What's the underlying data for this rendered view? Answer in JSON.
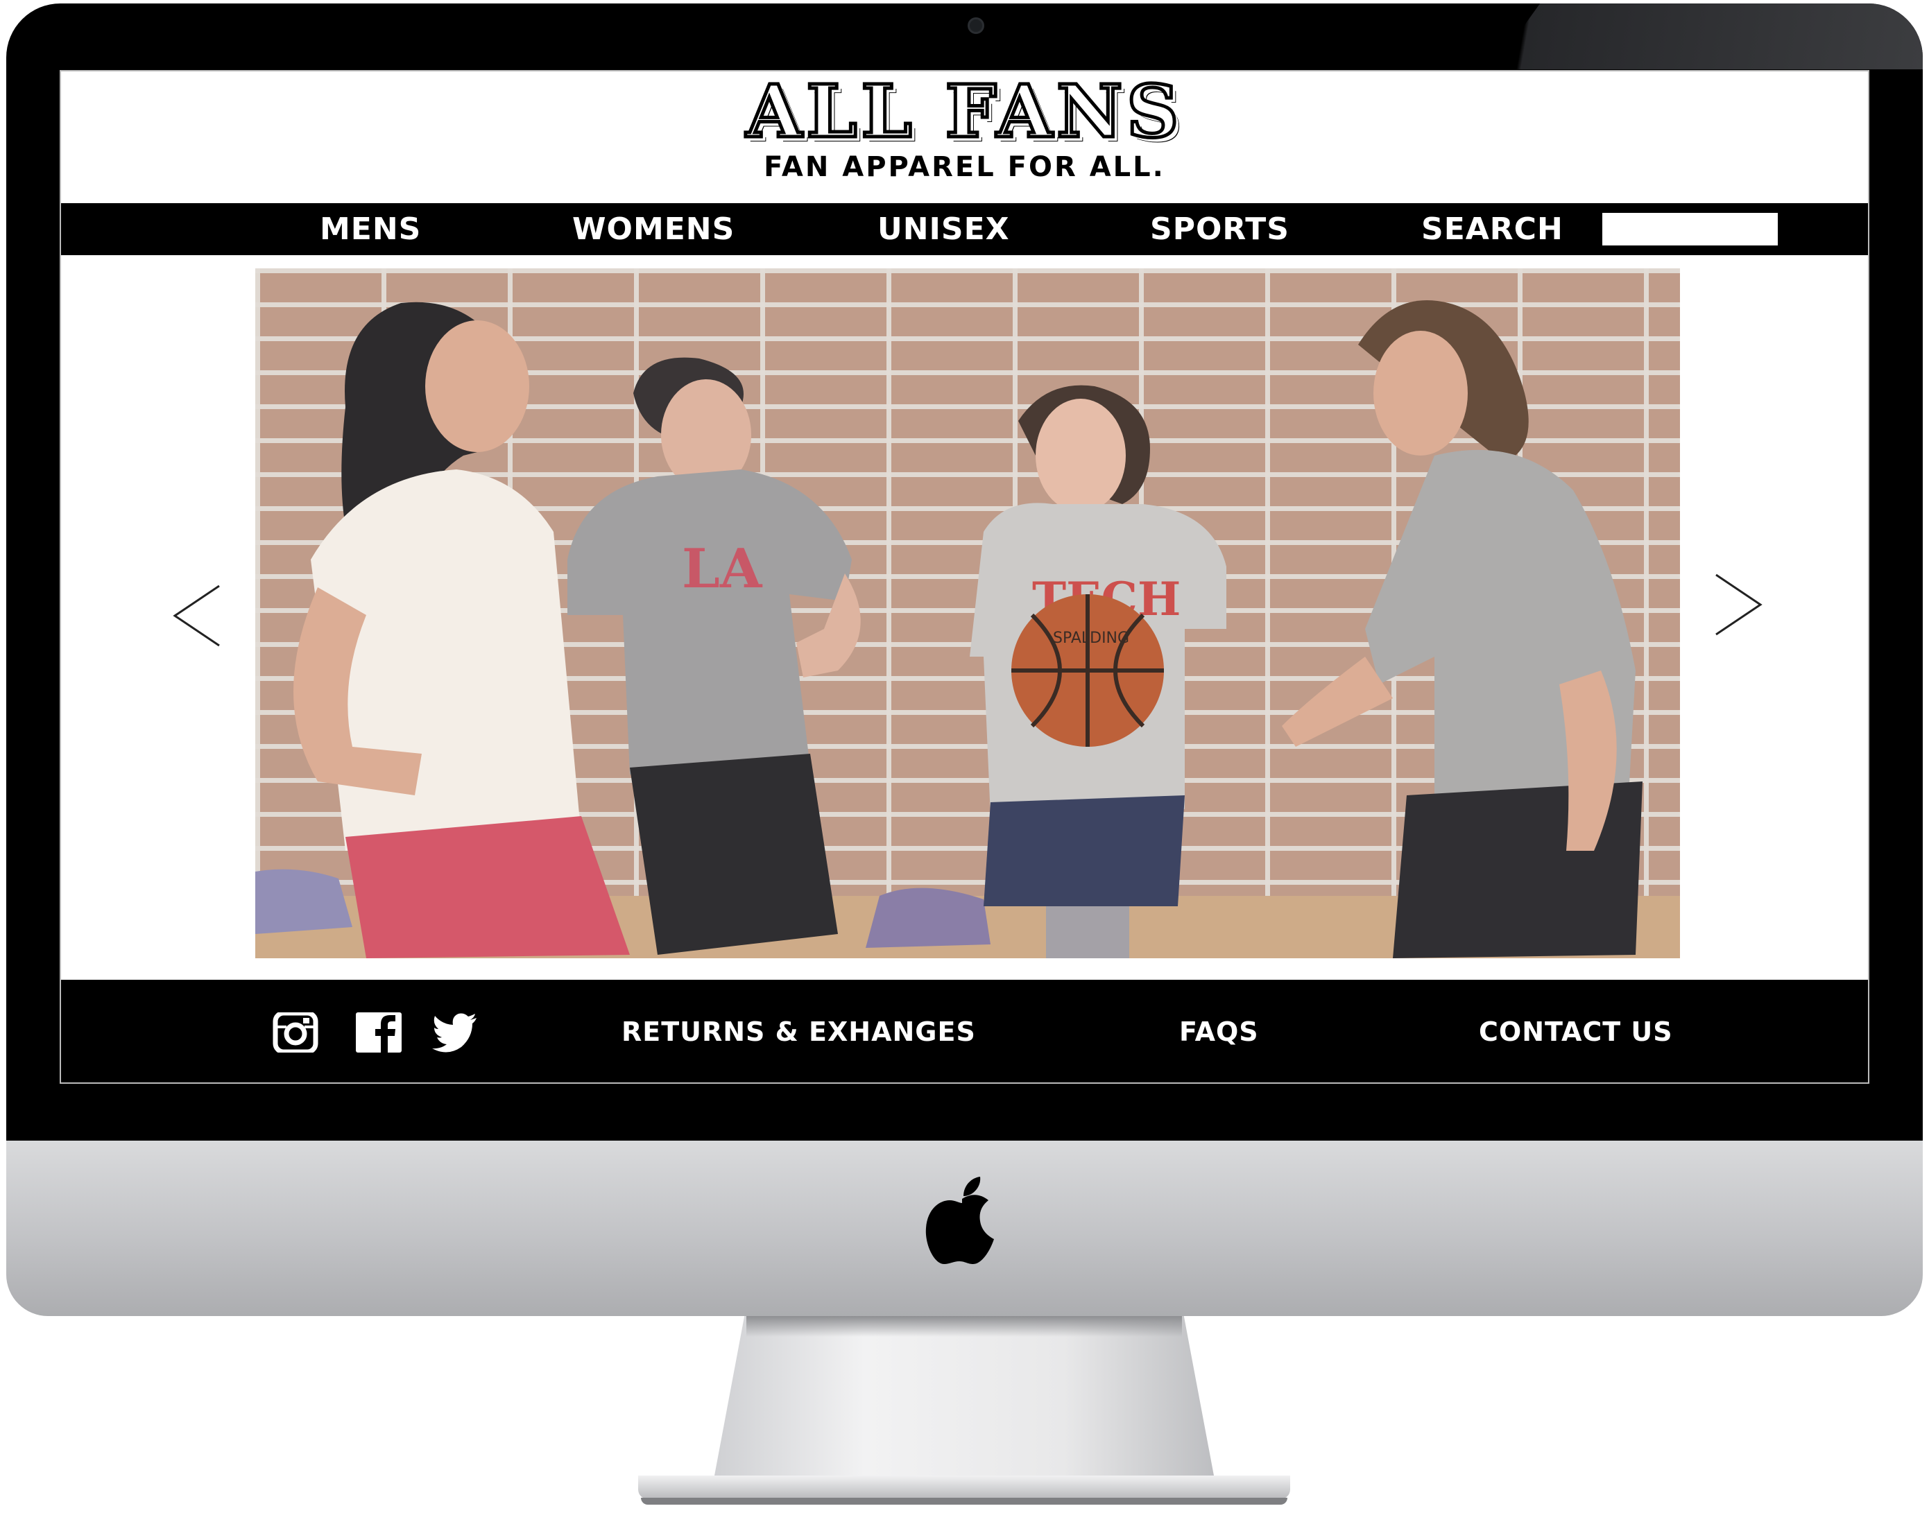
{
  "site": {
    "brand": "ALL FANS",
    "tagline": "FAN APPAREL FOR ALL."
  },
  "nav": {
    "items": [
      {
        "label": "MENS"
      },
      {
        "label": "WOMENS"
      },
      {
        "label": "UNISEX"
      },
      {
        "label": "SPORTS"
      },
      {
        "label": "SEARCH"
      }
    ],
    "search_value": ""
  },
  "hero": {
    "shirt_texts": [
      "LA",
      "TECH",
      "SPALDING"
    ],
    "prev_icon": "chevron-left-icon",
    "next_icon": "chevron-right-icon"
  },
  "footer": {
    "social_icons": [
      "instagram-icon",
      "facebook-icon",
      "twitter-icon"
    ],
    "links": [
      {
        "label": "RETURNS & EXHANGES"
      },
      {
        "label": "FAQS"
      },
      {
        "label": "CONTACT US"
      }
    ]
  },
  "device": {
    "logo_icon": "apple-logo-icon"
  },
  "colors": {
    "nav_background": "#000000",
    "nav_text": "#ffffff",
    "page_background": "#ffffff"
  }
}
